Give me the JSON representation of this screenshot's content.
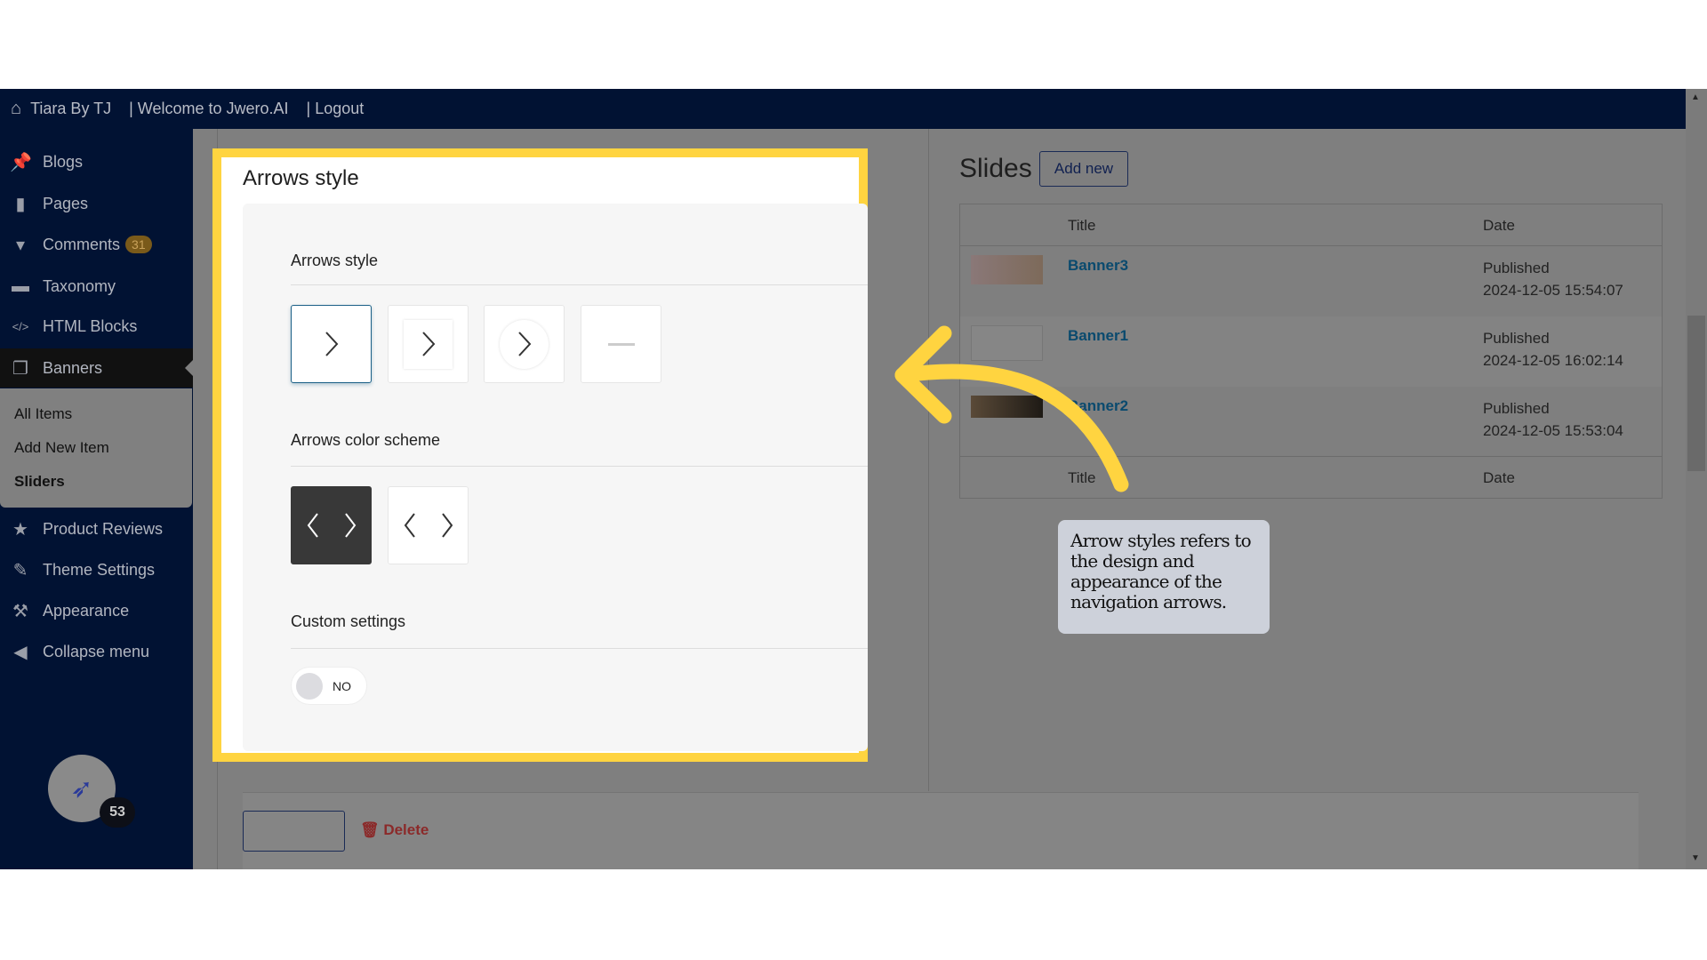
{
  "topbar": {
    "site": "Tiara By TJ",
    "welcome": "| Welcome to Jwero.AI",
    "logout": "| Logout"
  },
  "sidebar": {
    "items": [
      {
        "label": "Blogs",
        "icon": "pin-icon"
      },
      {
        "label": "Pages",
        "icon": "pages-icon"
      },
      {
        "label": "Comments",
        "icon": "comment-icon",
        "badge": "31"
      },
      {
        "label": "Taxonomy",
        "icon": "archive-icon"
      },
      {
        "label": "HTML Blocks",
        "icon": "code-icon"
      },
      {
        "label": "Banners",
        "icon": "gallery-icon"
      },
      {
        "label": "Product Reviews",
        "icon": "star-icon"
      },
      {
        "label": "Theme Settings",
        "icon": "brush-icon"
      },
      {
        "label": "Appearance",
        "icon": "hammer-icon"
      },
      {
        "label": "Collapse menu",
        "icon": "collapse-icon"
      }
    ],
    "submenu": [
      "All Items",
      "Add New Item",
      "Sliders"
    ],
    "avatar_badge": "53"
  },
  "panel": {
    "title": "Arrows style",
    "arrows_style_label": "Arrows style",
    "color_scheme_label": "Arrows color scheme",
    "custom_settings_label": "Custom settings",
    "toggle_value": "NO"
  },
  "slides": {
    "title": "Slides",
    "add_new": "Add new",
    "columns": [
      "Title",
      "Date"
    ],
    "rows": [
      {
        "title": "Banner3",
        "status": "Published",
        "date": "2024-12-05 15:54:07"
      },
      {
        "title": "Banner1",
        "status": "Published",
        "date": "2024-12-05 16:02:14"
      },
      {
        "title": "Banner2",
        "status": "Published",
        "date": "2024-12-05 15:53:04"
      }
    ]
  },
  "footer": {
    "delete": "Delete"
  },
  "tooltip": "Arrow styles refers to the design and appearance of the navigation arrows.",
  "colors": {
    "highlight": "#ffd440",
    "sidebar": "#011233",
    "link": "#0a4a6e",
    "delete": "#9b2a2a"
  }
}
